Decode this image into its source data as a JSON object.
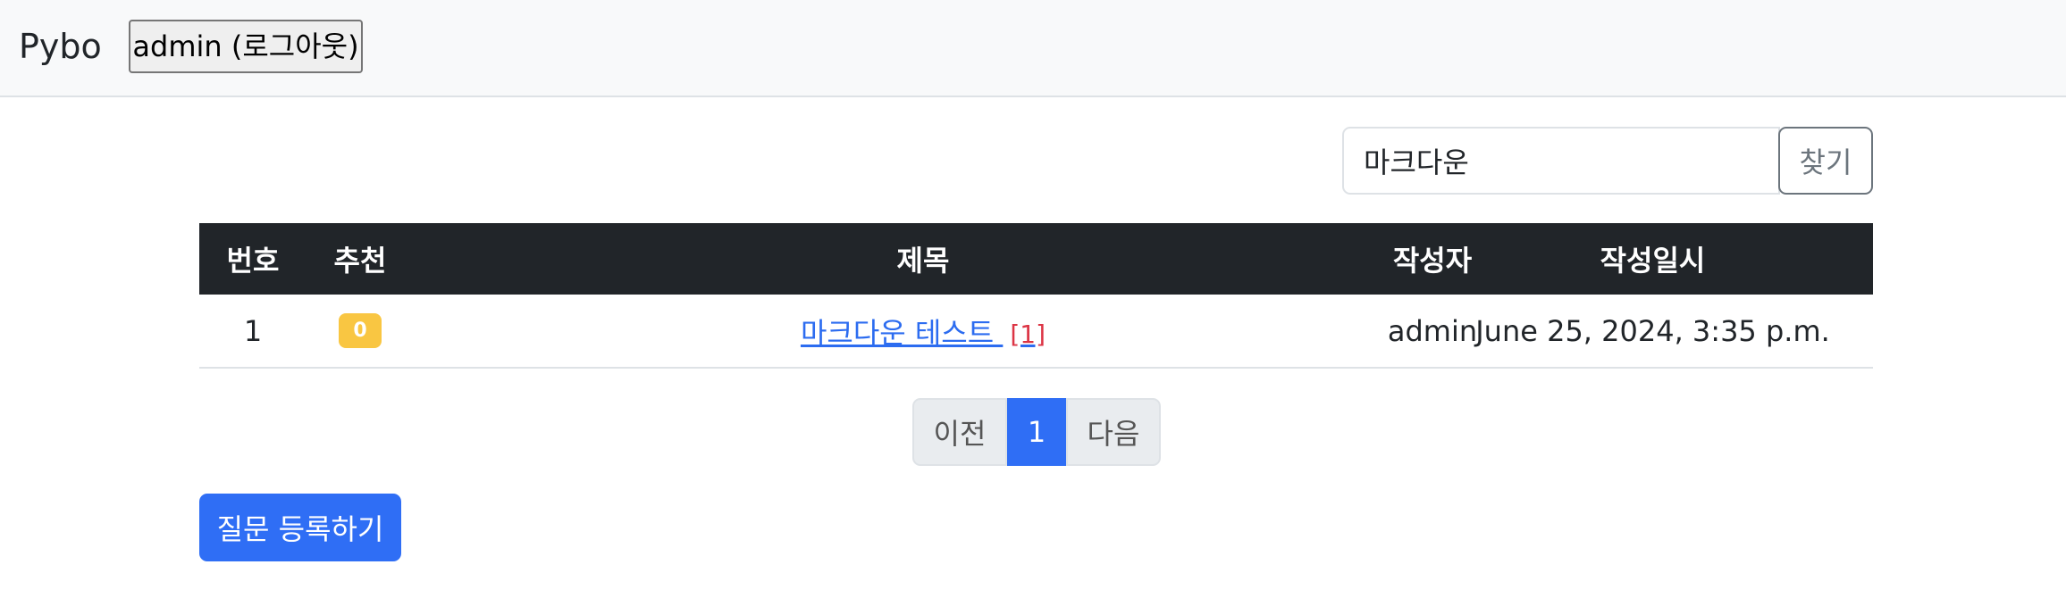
{
  "navbar": {
    "brand": "Pybo",
    "user_button": "admin (로그아웃)"
  },
  "search": {
    "value": "마크다운",
    "placeholder": "",
    "button_label": "찾기"
  },
  "table": {
    "headers": {
      "number": "번호",
      "recommend": "추천",
      "title": "제목",
      "author": "작성자",
      "date": "작성일시"
    },
    "rows": [
      {
        "number": "1",
        "recommend": "0",
        "title": "마크다운 테스트 ",
        "answer_count": "[1]",
        "author": "admin",
        "date": "June 25, 2024, 3:35 p.m."
      }
    ]
  },
  "pagination": {
    "prev": "이전",
    "current": "1",
    "next": "다음"
  },
  "create_button": "질문 등록하기",
  "colors": {
    "primary": "#2f6ef5",
    "dark_header": "#212529",
    "badge_warning": "#f9c642",
    "answer_count_red": "#dc3545",
    "navbar_bg": "#f8f9fa"
  }
}
